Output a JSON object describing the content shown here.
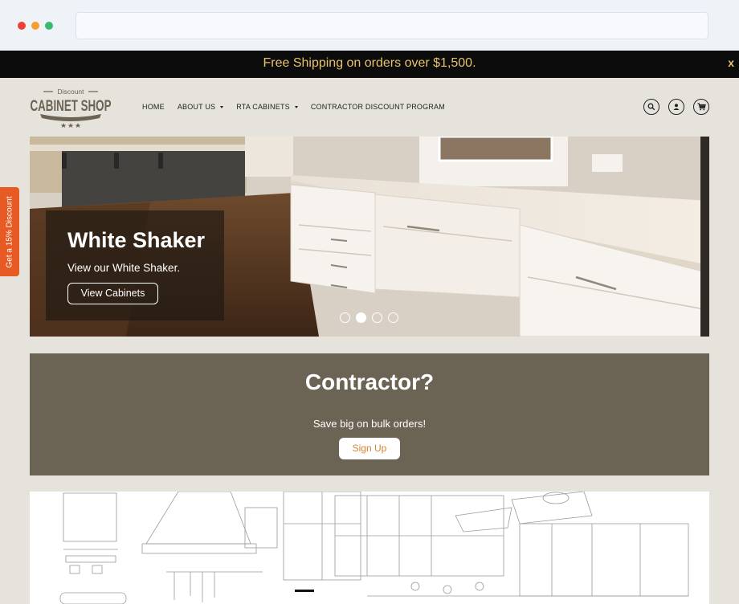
{
  "announcement": {
    "text": "Free Shipping on orders over $1,500.",
    "close": "x"
  },
  "logo": {
    "top_text": "Discount",
    "main_text": "CABINET SHOP"
  },
  "nav": {
    "items": [
      {
        "label": "HOME",
        "dropdown": false
      },
      {
        "label": "ABOUT US",
        "dropdown": true
      },
      {
        "label": "RTA CABINETS",
        "dropdown": true
      },
      {
        "label": "CONTRACTOR DISCOUNT PROGRAM",
        "dropdown": false
      }
    ]
  },
  "header_icons": [
    "search-icon",
    "account-icon",
    "cart-icon"
  ],
  "hero": {
    "title": "White Shaker",
    "subtitle": "View our White Shaker.",
    "button": "View Cabinets",
    "active_slide": 2,
    "slide_count": 4
  },
  "discount_tab": {
    "label": "Get a 15% Discount"
  },
  "contractor": {
    "title": "Contractor?",
    "subtitle": "Save big on bulk orders!",
    "button": "Sign Up"
  },
  "colors": {
    "announcement_bg": "#0c0c0c",
    "announcement_text": "#e8c266",
    "contractor_bg": "#6b6454",
    "signup_text": "#d8832e",
    "discount_tab": "#e75a24",
    "page_bg": "#e6e3dd"
  }
}
